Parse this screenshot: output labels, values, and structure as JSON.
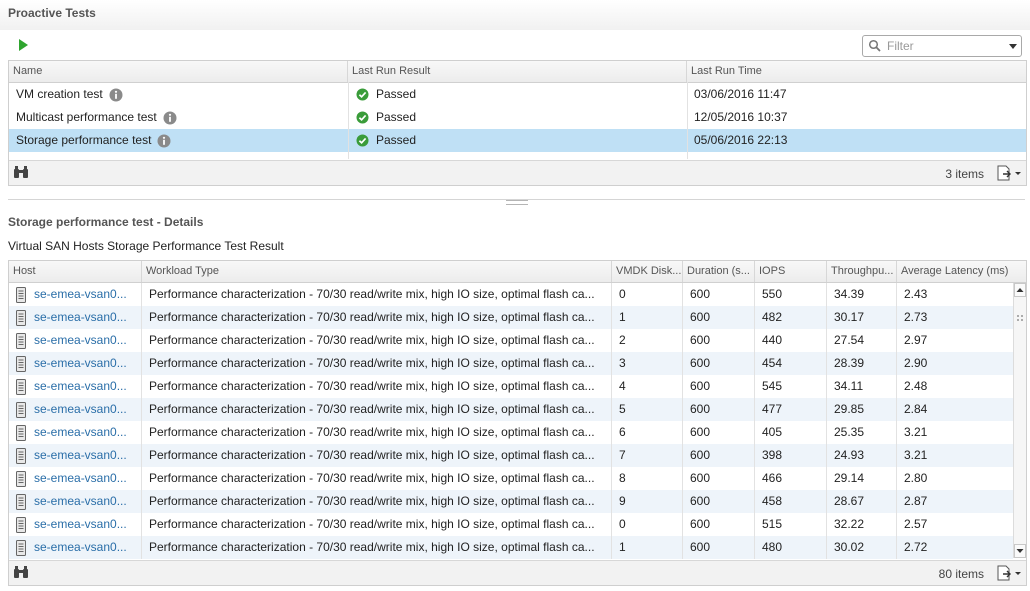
{
  "proactive": {
    "title": "Proactive Tests",
    "run_icon": "play-icon",
    "filter_placeholder": "Filter",
    "columns": [
      "Name",
      "Last Run Result",
      "Last Run Time"
    ],
    "rows": [
      {
        "name": "VM creation test",
        "result": "Passed",
        "time": "03/06/2016 11:47",
        "selected": false
      },
      {
        "name": "Multicast performance test",
        "result": "Passed",
        "time": "12/05/2016 10:37",
        "selected": false
      },
      {
        "name": "Storage performance test",
        "result": "Passed",
        "time": "05/06/2016 22:13",
        "selected": true
      }
    ],
    "count": "3 items"
  },
  "details": {
    "title": "Storage performance test - Details",
    "subtitle": "Virtual SAN Hosts Storage Performance Test Result",
    "columns": [
      "Host",
      "Workload Type",
      "VMDK Disk...",
      "Duration (s...",
      "IOPS",
      "Throughpu...",
      "Average Latency (ms)"
    ],
    "rows": [
      {
        "host": "se-emea-vsan0...",
        "workload": "Performance characterization - 70/30 read/write mix, high IO size, optimal flash ca...",
        "disk": "0",
        "duration": "600",
        "iops": "550",
        "throughput": "34.39",
        "latency": "2.43"
      },
      {
        "host": "se-emea-vsan0...",
        "workload": "Performance characterization - 70/30 read/write mix, high IO size, optimal flash ca...",
        "disk": "1",
        "duration": "600",
        "iops": "482",
        "throughput": "30.17",
        "latency": "2.73"
      },
      {
        "host": "se-emea-vsan0...",
        "workload": "Performance characterization - 70/30 read/write mix, high IO size, optimal flash ca...",
        "disk": "2",
        "duration": "600",
        "iops": "440",
        "throughput": "27.54",
        "latency": "2.97"
      },
      {
        "host": "se-emea-vsan0...",
        "workload": "Performance characterization - 70/30 read/write mix, high IO size, optimal flash ca...",
        "disk": "3",
        "duration": "600",
        "iops": "454",
        "throughput": "28.39",
        "latency": "2.90"
      },
      {
        "host": "se-emea-vsan0...",
        "workload": "Performance characterization - 70/30 read/write mix, high IO size, optimal flash ca...",
        "disk": "4",
        "duration": "600",
        "iops": "545",
        "throughput": "34.11",
        "latency": "2.48"
      },
      {
        "host": "se-emea-vsan0...",
        "workload": "Performance characterization - 70/30 read/write mix, high IO size, optimal flash ca...",
        "disk": "5",
        "duration": "600",
        "iops": "477",
        "throughput": "29.85",
        "latency": "2.84"
      },
      {
        "host": "se-emea-vsan0...",
        "workload": "Performance characterization - 70/30 read/write mix, high IO size, optimal flash ca...",
        "disk": "6",
        "duration": "600",
        "iops": "405",
        "throughput": "25.35",
        "latency": "3.21"
      },
      {
        "host": "se-emea-vsan0...",
        "workload": "Performance characterization - 70/30 read/write mix, high IO size, optimal flash ca...",
        "disk": "7",
        "duration": "600",
        "iops": "398",
        "throughput": "24.93",
        "latency": "3.21"
      },
      {
        "host": "se-emea-vsan0...",
        "workload": "Performance characterization - 70/30 read/write mix, high IO size, optimal flash ca...",
        "disk": "8",
        "duration": "600",
        "iops": "466",
        "throughput": "29.14",
        "latency": "2.80"
      },
      {
        "host": "se-emea-vsan0...",
        "workload": "Performance characterization - 70/30 read/write mix, high IO size, optimal flash ca...",
        "disk": "9",
        "duration": "600",
        "iops": "458",
        "throughput": "28.67",
        "latency": "2.87"
      },
      {
        "host": "se-emea-vsan0...",
        "workload": "Performance characterization - 70/30 read/write mix, high IO size, optimal flash ca...",
        "disk": "0",
        "duration": "600",
        "iops": "515",
        "throughput": "32.22",
        "latency": "2.57"
      },
      {
        "host": "se-emea-vsan0...",
        "workload": "Performance characterization - 70/30 read/write mix, high IO size, optimal flash ca...",
        "disk": "1",
        "duration": "600",
        "iops": "480",
        "throughput": "30.02",
        "latency": "2.72"
      }
    ],
    "count": "80 items"
  },
  "icons": {
    "play": "play-icon",
    "search": "search-icon",
    "info": "info-icon",
    "passed": "check-circle-icon",
    "binoculars": "binoculars-icon",
    "export": "export-icon",
    "host": "host-server-icon"
  },
  "colors": {
    "selected_row": "#bfe0f5",
    "alt_row": "#eef4fa",
    "link": "#2a6ea8",
    "passed_green": "#3a9c3a",
    "play_green": "#2fa52f"
  }
}
